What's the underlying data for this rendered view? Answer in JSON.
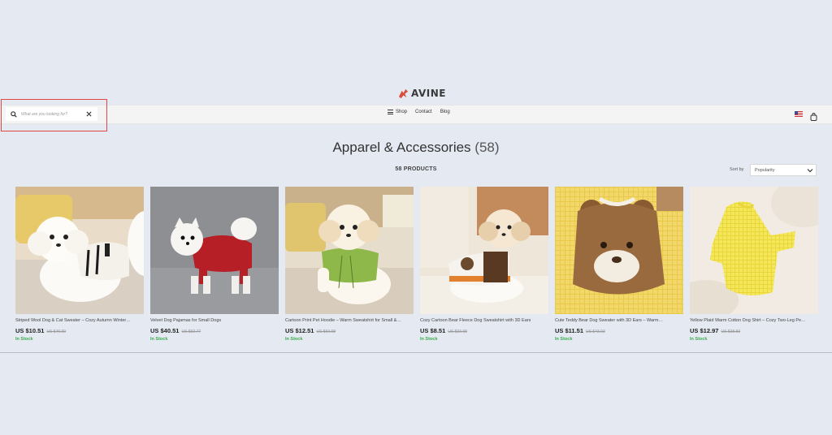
{
  "brand": {
    "name": "AVINE",
    "accent": "#d94e3c"
  },
  "search": {
    "placeholder": "What are you looking for?"
  },
  "nav": {
    "shop": "Shop",
    "contact": "Contact",
    "blog": "Blog"
  },
  "header_icons": [
    "us-flag-icon",
    "shopping-bag-icon"
  ],
  "page": {
    "title": "Apparel & Accessories",
    "title_count": "(58)",
    "products_count": "58 PRODUCTS"
  },
  "sort": {
    "label": "Sort by",
    "selected": "Popularity"
  },
  "products": [
    {
      "name": "Striped Wool Dog & Cat Sweater – Cozy Autumn Winter…",
      "price": "US $10.51",
      "old_price": "US $49.99",
      "stock": "In Stock"
    },
    {
      "name": "Velvet Dog Pajamas for Small Dogs",
      "price": "US $40.51",
      "old_price": "US $92.77",
      "stock": "In Stock"
    },
    {
      "name": "Cartoon Print Pet Hoodie – Warm Sweatshirt for Small &…",
      "price": "US $12.51",
      "old_price": "US $69.98",
      "stock": "In Stock"
    },
    {
      "name": "Cozy Cartoon Bear Fleece Dog Sweatshirt with 3D Ears",
      "price": "US $8.51",
      "old_price": "US $33.98",
      "stock": "In Stock"
    },
    {
      "name": "Cute Teddy Bear Dog Sweater with 3D Ears – Warm…",
      "price": "US $11.51",
      "old_price": "US $43.93",
      "stock": "In Stock"
    },
    {
      "name": "Yellow Plaid Warm Cotton Dog Shirt – Cozy Two-Leg Pe…",
      "price": "US $12.97",
      "old_price": "US $38.83",
      "stock": "In Stock"
    }
  ],
  "colors": {
    "in_stock": "#3aab4b",
    "highlight": "#e04848",
    "background": "#e5e9f2"
  }
}
